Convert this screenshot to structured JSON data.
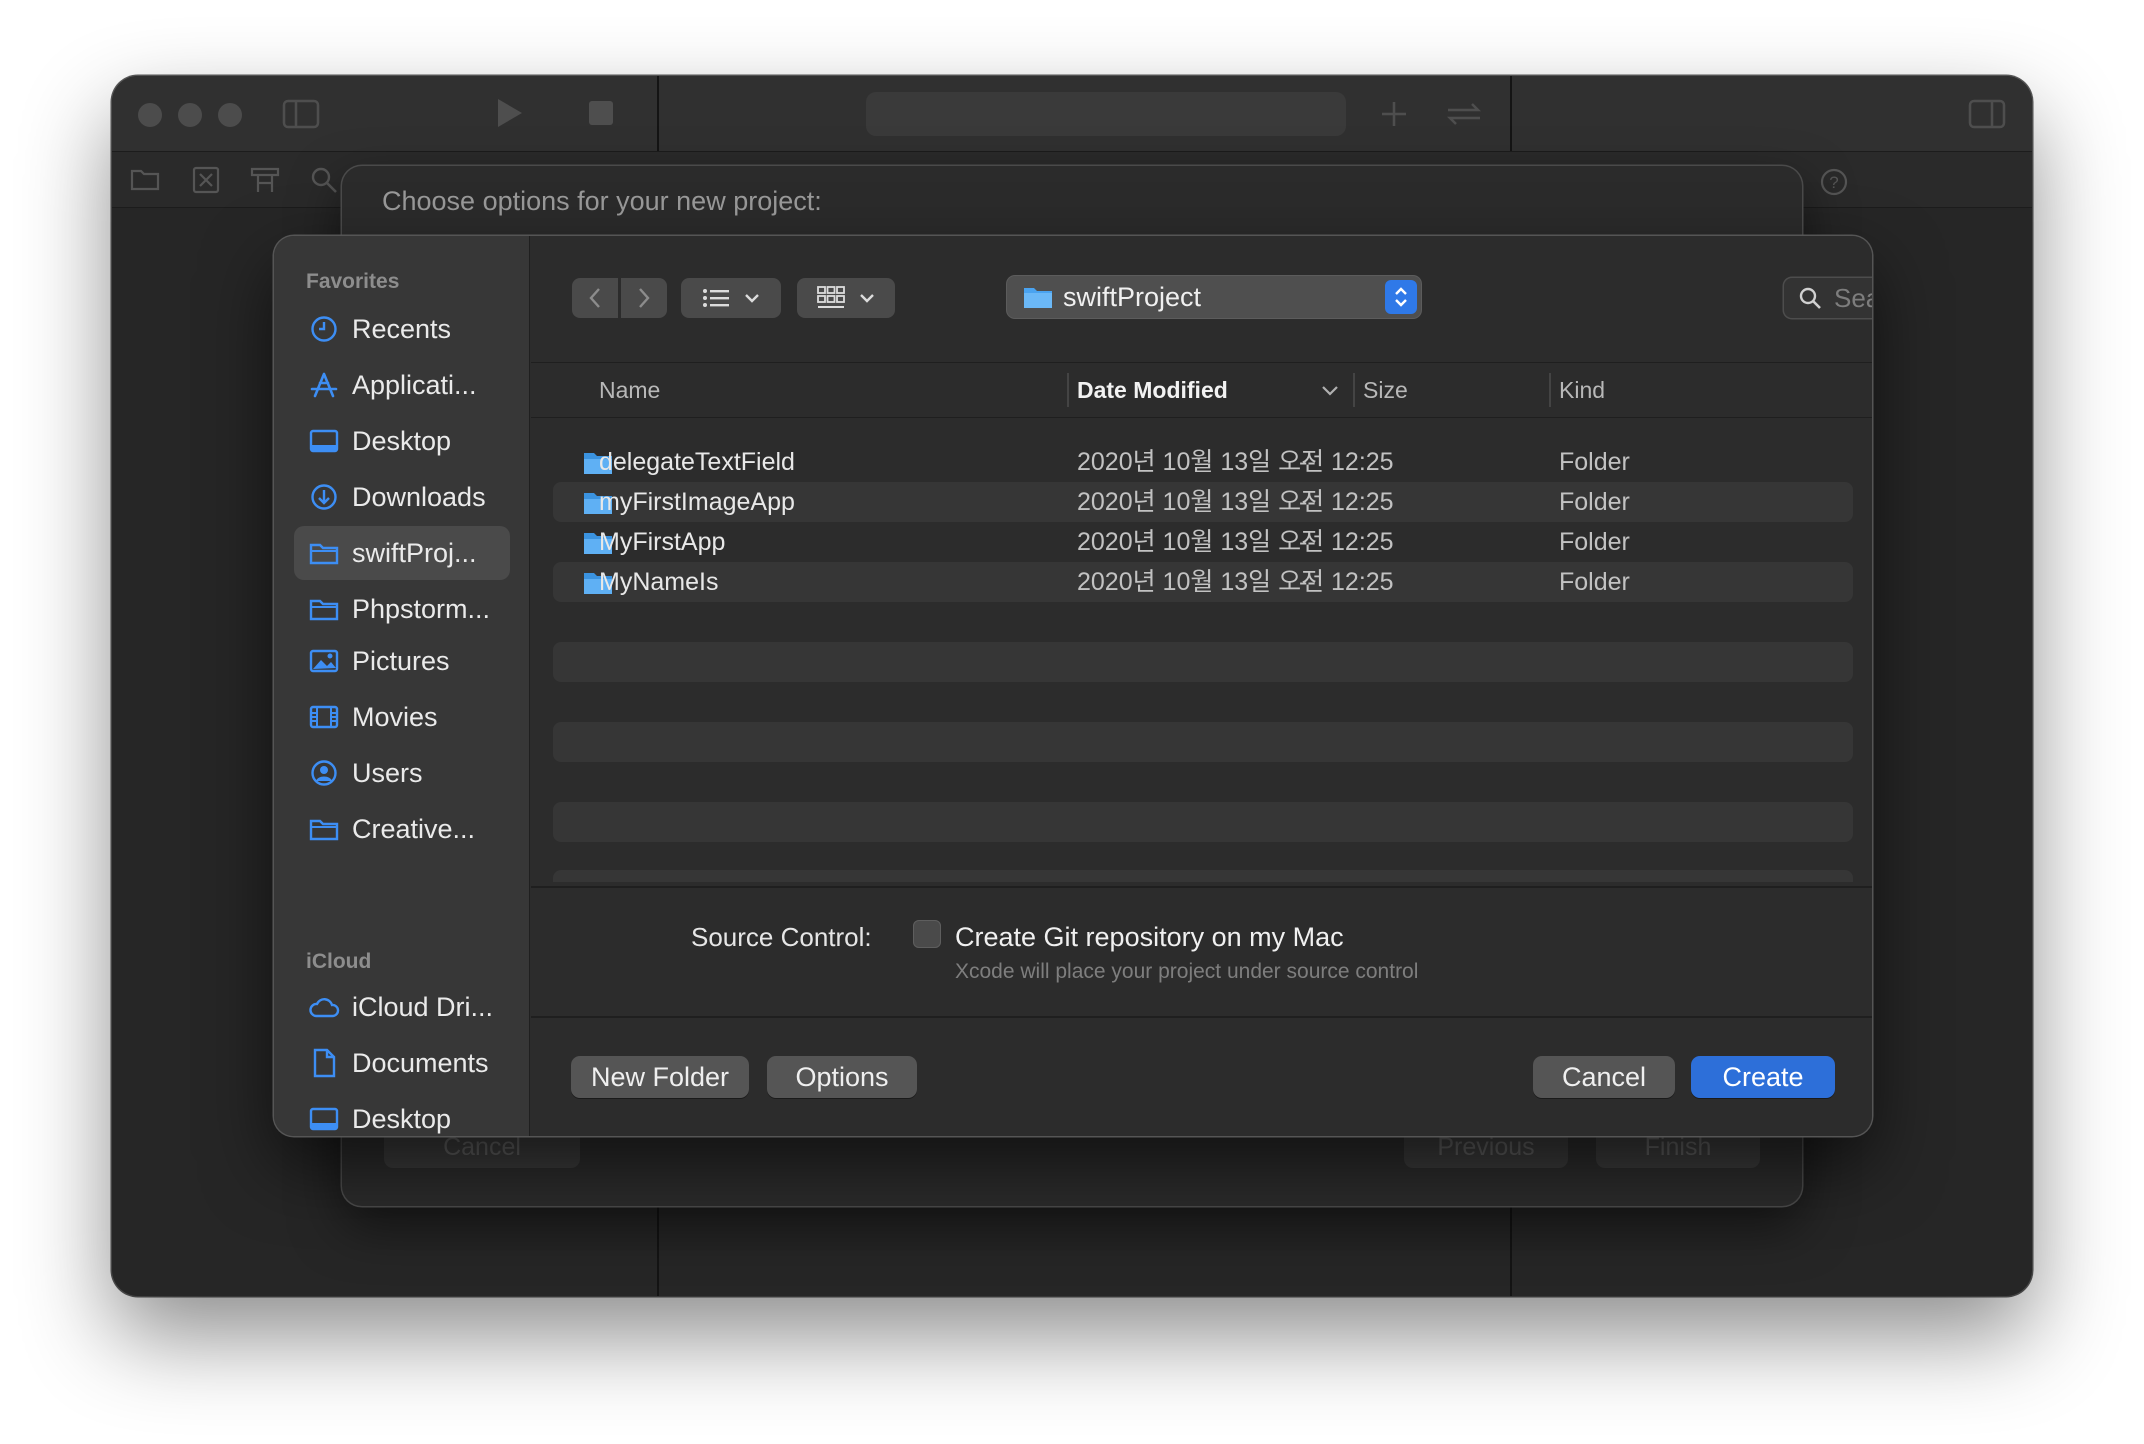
{
  "sheet": {
    "title": "Choose options for your new project:",
    "cancel_label": "Cancel",
    "previous_label": "Previous",
    "finish_label": "Finish"
  },
  "sidebar": {
    "favorites_title": "Favorites",
    "favorites": [
      {
        "label": "Recents",
        "icon": "clock-icon"
      },
      {
        "label": "Applicati...",
        "icon": "applications-icon"
      },
      {
        "label": "Desktop",
        "icon": "desktop-icon"
      },
      {
        "label": "Downloads",
        "icon": "download-icon"
      },
      {
        "label": "swiftProj...",
        "icon": "folder-icon",
        "selected": true
      },
      {
        "label": "Phpstorm...",
        "icon": "folder-icon"
      },
      {
        "label": "Pictures",
        "icon": "pictures-icon"
      },
      {
        "label": "Movies",
        "icon": "movies-icon"
      },
      {
        "label": "Users",
        "icon": "user-icon"
      },
      {
        "label": "Creative...",
        "icon": "folder-icon"
      }
    ],
    "icloud_title": "iCloud",
    "icloud": [
      {
        "label": "iCloud Dri...",
        "icon": "cloud-icon"
      },
      {
        "label": "Documents",
        "icon": "document-icon"
      },
      {
        "label": "Desktop",
        "icon": "desktop-icon"
      }
    ]
  },
  "toolbar": {
    "location": "swiftProject",
    "search_placeholder": "Search"
  },
  "table": {
    "columns": [
      "Name",
      "Date Modified",
      "Size",
      "Kind"
    ],
    "sorted_column": "Date Modified",
    "rows": [
      {
        "name": "delegateTextField",
        "date": "2020년 10월 13일 오전 12:25",
        "size": "--",
        "kind": "Folder"
      },
      {
        "name": "myFirstImageApp",
        "date": "2020년 10월 13일 오전 12:25",
        "size": "--",
        "kind": "Folder"
      },
      {
        "name": "MyFirstApp",
        "date": "2020년 10월 13일 오전 12:25",
        "size": "--",
        "kind": "Folder"
      },
      {
        "name": "MyNameIs",
        "date": "2020년 10월 13일 오전 12:25",
        "size": "--",
        "kind": "Folder"
      }
    ]
  },
  "source_control": {
    "label": "Source Control:",
    "checkbox_label": "Create Git repository on my Mac",
    "checked": false,
    "hint": "Xcode will place your project under source control"
  },
  "footer": {
    "new_folder_label": "New Folder",
    "options_label": "Options",
    "cancel_label": "Cancel",
    "create_label": "Create"
  },
  "colors": {
    "accent": "#2d6fd9",
    "sidebar_icon": "#3d8ef4",
    "folder": "#4aa3f0"
  }
}
